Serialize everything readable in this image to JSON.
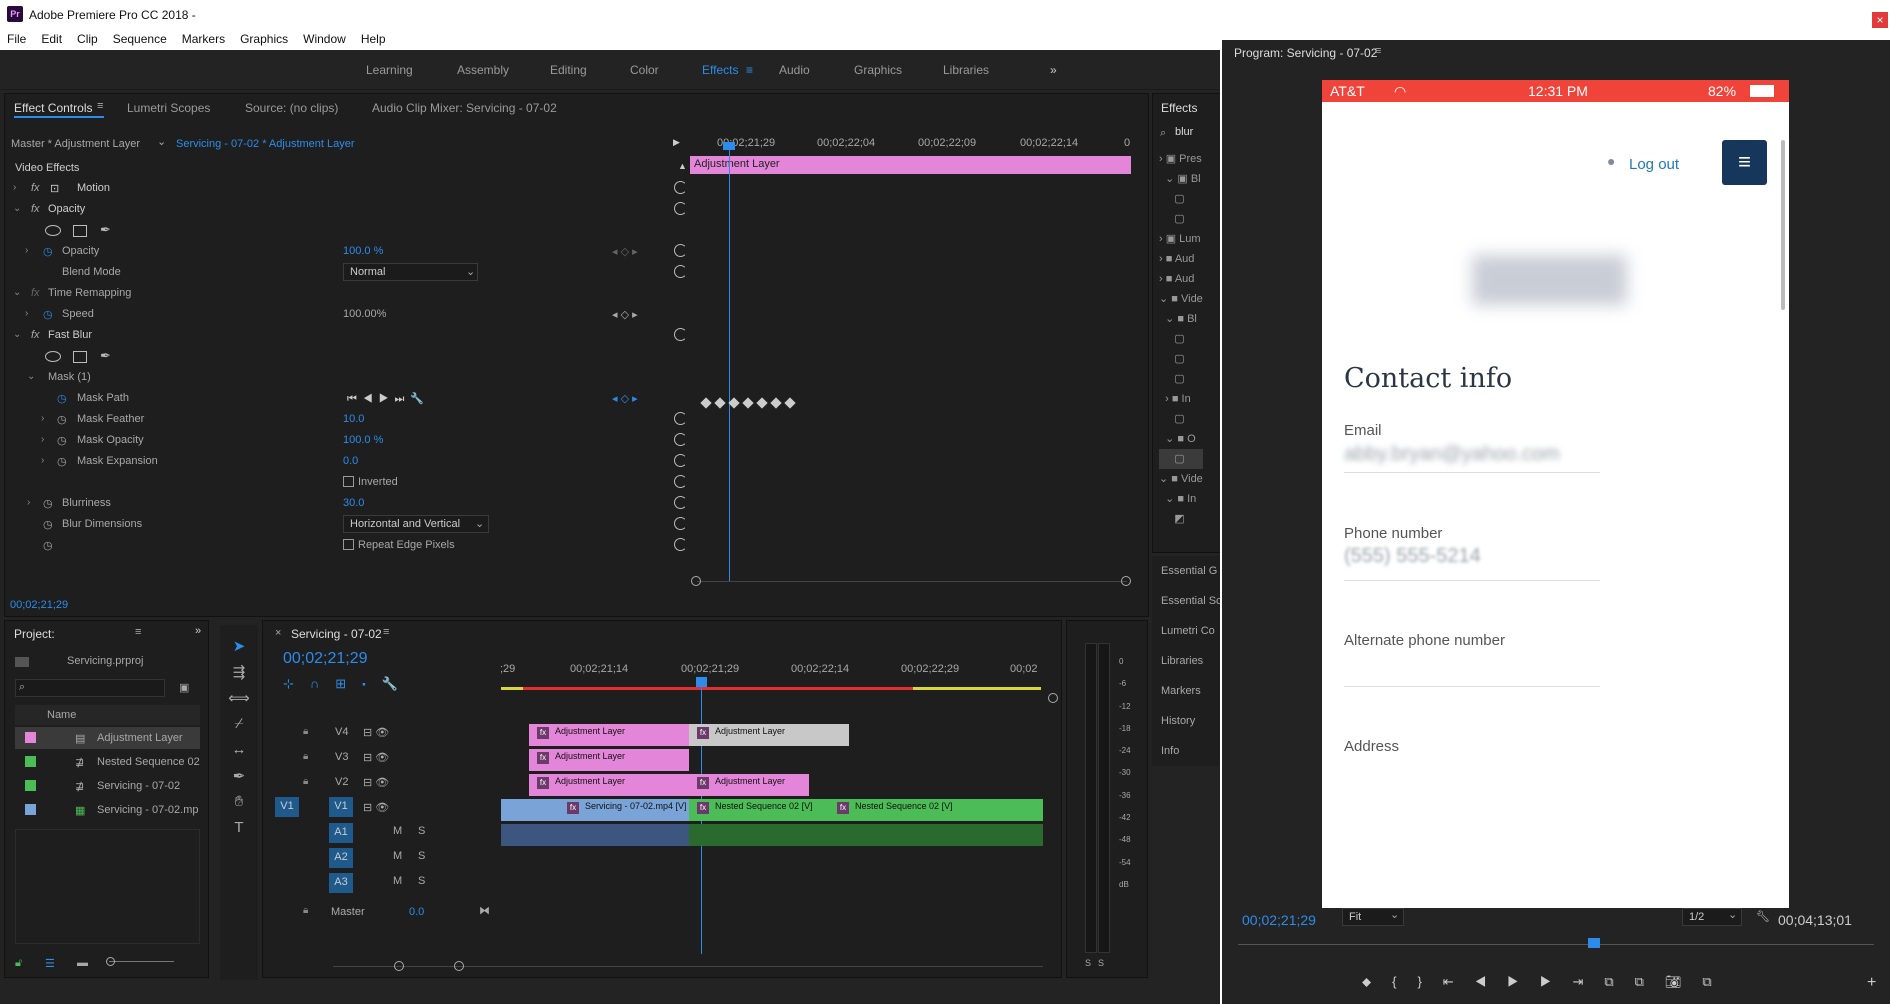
{
  "app": {
    "title": "Adobe Premiere Pro CC 2018 -",
    "logo": "Pr"
  },
  "menu": [
    "File",
    "Edit",
    "Clip",
    "Sequence",
    "Markers",
    "Graphics",
    "Window",
    "Help"
  ],
  "workspaces": [
    "Learning",
    "Assembly",
    "Editing",
    "Color",
    "Effects",
    "Audio",
    "Graphics",
    "Libraries"
  ],
  "workspace_active": "Effects",
  "source_panel": {
    "tabs": [
      "Effect Controls",
      "Lumetri Scopes",
      "Source: (no clips)",
      "Audio Clip Mixer: Servicing - 07-02"
    ],
    "master": "Master * Adjustment Layer",
    "sequence": "Servicing - 07-02 * Adjustment Layer",
    "video_effects": "Video Effects",
    "timecodes": [
      "00;02;21;29",
      "00;02;22;04",
      "00;02;22;09",
      "00;02;22;14",
      "0"
    ],
    "clip_bar": "Adjustment Layer",
    "rows": {
      "motion": "Motion",
      "opacity": "Opacity",
      "opacity_prop": "Opacity",
      "opacity_val": "100.0 %",
      "blend_mode": "Blend Mode",
      "blend_val": "Normal",
      "time_remap": "Time Remapping",
      "speed": "Speed",
      "speed_val": "100.00%",
      "fast_blur": "Fast Blur",
      "mask": "Mask (1)",
      "mask_path": "Mask Path",
      "mask_feather": "Mask Feather",
      "mask_feather_val": "10.0",
      "mask_opacity": "Mask Opacity",
      "mask_opacity_val": "100.0 %",
      "mask_expansion": "Mask Expansion",
      "mask_expansion_val": "0.0",
      "inverted": "Inverted",
      "blurriness": "Blurriness",
      "blurriness_val": "30.0",
      "blur_dim": "Blur Dimensions",
      "blur_dim_val": "Horizontal and Vertical",
      "repeat_edge": "Repeat Edge Pixels"
    },
    "current_time": "00;02;21;29"
  },
  "effects_panel": {
    "title": "Effects",
    "search": "blur",
    "items": [
      "Pres",
      "Bl",
      "Lum",
      "Aud",
      "Aud",
      "Vide",
      "Bl",
      "In",
      "O",
      "Vide",
      "In"
    ],
    "tabs": [
      "Essential G",
      "Essential Sc",
      "Lumetri Co",
      "Libraries",
      "Markers",
      "History",
      "Info"
    ]
  },
  "project": {
    "title": "Project:",
    "file": "Servicing.prproj",
    "col": "Name",
    "items": [
      {
        "name": "Adjustment Layer",
        "color": "#e385d8"
      },
      {
        "name": "Nested Sequence 02",
        "color": "#4cbd56"
      },
      {
        "name": "Servicing - 07-02",
        "color": "#4cbd56"
      },
      {
        "name": "Servicing - 07-02.mp",
        "color": "#7aa3d8"
      }
    ]
  },
  "timeline": {
    "title": "Servicing - 07-02",
    "timecode": "00;02;21;29",
    "ruler": [
      ";29",
      "00;02;21;14",
      "00;02;21;29",
      "00;02;22;14",
      "00;02;22;29",
      "00;02"
    ],
    "tracks_v": [
      "V4",
      "V3",
      "V2",
      "V1"
    ],
    "tracks_a": [
      "A1",
      "A2",
      "A3"
    ],
    "v1_src": "V1",
    "master": "Master",
    "master_val": "0.0",
    "m": "M",
    "s": "S",
    "clips": {
      "adj": "Adjustment Layer",
      "serv": "Servicing - 07-02.mp4 [V]",
      "nest": "Nested Sequence 02 [V]",
      "fx": "fx"
    }
  },
  "meter": {
    "ticks": [
      "0",
      "-6",
      "-12",
      "-18",
      "-24",
      "-30",
      "-36",
      "-42",
      "-48",
      "-54",
      "dB"
    ],
    "solo": [
      "S",
      "S"
    ]
  },
  "program": {
    "title": "Program: Servicing - 07-02",
    "timecode": "00;02;21;29",
    "fit": "Fit",
    "res": "1/2",
    "duration": "00;04;13;01"
  },
  "phone": {
    "carrier": "AT&T",
    "time": "12:31 PM",
    "battery": "82%",
    "logout": "Log out",
    "heading": "Contact info",
    "email_label": "Email",
    "email_val": "abby.bryan@yahoo.com",
    "phone_label": "Phone number",
    "phone_val": "(555) 555-5214",
    "alt_label": "Alternate phone number",
    "address_label": "Address"
  }
}
